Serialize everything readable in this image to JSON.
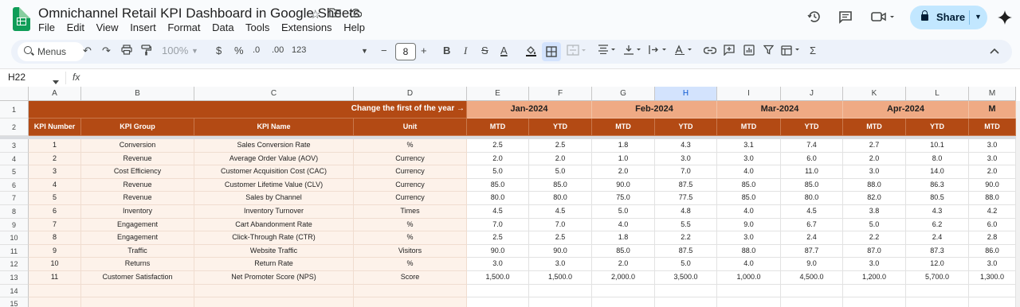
{
  "app": {
    "title": "Omnichannel Retail KPI Dashboard in Google Sheets",
    "menu": [
      "File",
      "Edit",
      "View",
      "Insert",
      "Format",
      "Data",
      "Tools",
      "Extensions",
      "Help"
    ],
    "share_label": "Share"
  },
  "toolbar": {
    "menus_label": "Menus",
    "zoom": "100%",
    "currency": "$",
    "percent": "%",
    "decrease_decimal": ".0",
    "increase_decimal": ".00",
    "number_format": "123",
    "font_size": "8"
  },
  "formula_bar": {
    "name_box": "H22",
    "fx": "fx"
  },
  "columns": [
    "A",
    "B",
    "C",
    "D",
    "E",
    "F",
    "G",
    "H",
    "I",
    "J",
    "K",
    "L",
    "M"
  ],
  "selected_column": "H",
  "row_numbers": [
    "1",
    "2",
    "3",
    "4",
    "5",
    "6",
    "7",
    "8",
    "9",
    "10",
    "11",
    "12",
    "13",
    "14",
    "15"
  ],
  "sheet": {
    "banner": "Change the first of the year →",
    "months": [
      "Jan-2024",
      "Feb-2024",
      "Mar-2024",
      "Apr-2024",
      "M"
    ],
    "headers": [
      "KPI Number",
      "KPI Group",
      "KPI Name",
      "Unit"
    ],
    "sub_headers": [
      "MTD",
      "YTD",
      "MTD",
      "YTD",
      "MTD",
      "YTD",
      "MTD",
      "YTD",
      "MTD"
    ],
    "rows": [
      [
        "1",
        "Conversion",
        "Sales Conversion Rate",
        "%",
        "2.5",
        "2.5",
        "1.8",
        "4.3",
        "3.1",
        "7.4",
        "2.7",
        "10.1",
        "3.0"
      ],
      [
        "2",
        "Revenue",
        "Average Order Value (AOV)",
        "Currency",
        "2.0",
        "2.0",
        "1.0",
        "3.0",
        "3.0",
        "6.0",
        "2.0",
        "8.0",
        "3.0"
      ],
      [
        "3",
        "Cost Efficiency",
        "Customer Acquisition Cost (CAC)",
        "Currency",
        "5.0",
        "5.0",
        "2.0",
        "7.0",
        "4.0",
        "11.0",
        "3.0",
        "14.0",
        "2.0"
      ],
      [
        "4",
        "Revenue",
        "Customer Lifetime Value (CLV)",
        "Currency",
        "85.0",
        "85.0",
        "90.0",
        "87.5",
        "85.0",
        "85.0",
        "88.0",
        "86.3",
        "90.0"
      ],
      [
        "5",
        "Revenue",
        "Sales by Channel",
        "Currency",
        "80.0",
        "80.0",
        "75.0",
        "77.5",
        "85.0",
        "80.0",
        "82.0",
        "80.5",
        "88.0"
      ],
      [
        "6",
        "Inventory",
        "Inventory Turnover",
        "Times",
        "4.5",
        "4.5",
        "5.0",
        "4.8",
        "4.0",
        "4.5",
        "3.8",
        "4.3",
        "4.2"
      ],
      [
        "7",
        "Engagement",
        "Cart Abandonment Rate",
        "%",
        "7.0",
        "7.0",
        "4.0",
        "5.5",
        "9.0",
        "6.7",
        "5.0",
        "6.2",
        "6.0"
      ],
      [
        "8",
        "Engagement",
        "Click-Through Rate (CTR)",
        "%",
        "2.5",
        "2.5",
        "1.8",
        "2.2",
        "3.0",
        "2.4",
        "2.2",
        "2.4",
        "2.8"
      ],
      [
        "9",
        "Traffic",
        "Website Traffic",
        "Visitors",
        "90.0",
        "90.0",
        "85.0",
        "87.5",
        "88.0",
        "87.7",
        "87.0",
        "87.3",
        "86.0"
      ],
      [
        "10",
        "Returns",
        "Return Rate",
        "%",
        "3.0",
        "3.0",
        "2.0",
        "5.0",
        "4.0",
        "9.0",
        "3.0",
        "12.0",
        "3.0"
      ],
      [
        "11",
        "Customer Satisfaction",
        "Net Promoter Score (NPS)",
        "Score",
        "1,500.0",
        "1,500.0",
        "2,000.0",
        "3,500.0",
        "1,000.0",
        "4,500.0",
        "1,200.0",
        "5,700.0",
        "1,300.0"
      ]
    ]
  },
  "colors": {
    "header_brown": "#b34a14",
    "month_peach": "#efaa84",
    "band_fill": "#fdf2ea",
    "share_bg": "#c2e7ff",
    "toolbar_bg": "#edf2fa"
  }
}
